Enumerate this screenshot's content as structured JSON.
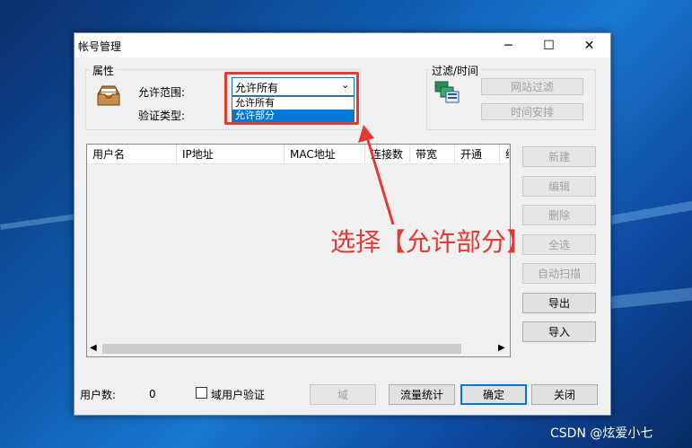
{
  "window": {
    "title": "帐号管理",
    "controls": {
      "minimize": "─",
      "maximize": "☐",
      "close": "✕"
    }
  },
  "properties": {
    "legend": "属性",
    "range_label": "允许范围:",
    "range_value": "允许所有",
    "range_options": [
      "允许所有",
      "允许部分"
    ],
    "range_highlighted": "允许部分",
    "auth_label": "验证类型:"
  },
  "filter": {
    "legend": "过滤/时间",
    "website_filter": "网站过滤",
    "schedule": "时间安排"
  },
  "list": {
    "columns": [
      "用户名",
      "IP地址",
      "MAC地址",
      "连接数",
      "带宽",
      "开通",
      "约"
    ]
  },
  "side_buttons": {
    "new": "新建",
    "edit": "编辑",
    "delete": "删除",
    "select_all": "全选",
    "auto_scan": "自动扫描",
    "export": "导出",
    "import": "导入"
  },
  "footer": {
    "user_count_label": "用户数:",
    "user_count": "0",
    "domain_verify": "域用户验证",
    "domain": "域",
    "traffic_stats": "流量统计",
    "ok": "确定",
    "close": "关闭"
  },
  "annotation": {
    "text": "选择【允许部分】",
    "color": "#e53935"
  },
  "watermark": "CSDN @炫爱小七",
  "colors": {
    "accent": "#0078d7",
    "annotation_red": "#e53935",
    "disabled_text": "#a0a0a0"
  }
}
